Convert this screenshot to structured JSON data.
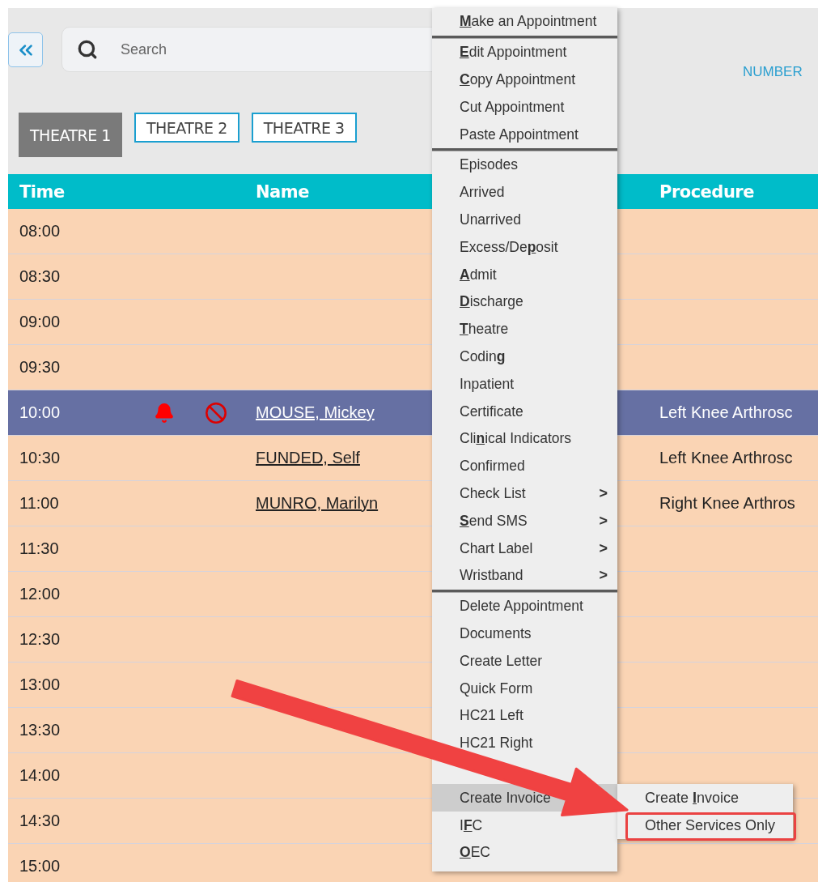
{
  "search": {
    "placeholder": "Search"
  },
  "header_link": "NUMBER",
  "theatre_tabs": [
    {
      "label": "THEATRE 1",
      "selected": true
    },
    {
      "label": "THEATRE 2",
      "selected": false
    },
    {
      "label": "THEATRE 3",
      "selected": false
    }
  ],
  "table": {
    "columns": [
      "Time",
      "Name",
      "Procedure"
    ],
    "rows": [
      {
        "time": "08:00",
        "selected": false,
        "alert": false,
        "blocked": false
      },
      {
        "time": "08:30",
        "selected": false,
        "alert": false,
        "blocked": false
      },
      {
        "time": "09:00",
        "selected": false,
        "alert": false,
        "blocked": false
      },
      {
        "time": "09:30",
        "selected": false,
        "alert": false,
        "blocked": false
      },
      {
        "time": "10:00",
        "name": "MOUSE, Mickey",
        "procedure": "Left Knee Arthrosc",
        "selected": true,
        "alert": true,
        "blocked": true
      },
      {
        "time": "10:30",
        "name": "FUNDED, Self",
        "procedure": "Left Knee Arthrosc",
        "selected": false,
        "alert": false,
        "blocked": false
      },
      {
        "time": "11:00",
        "name": "MUNRO, Marilyn",
        "procedure": "Right Knee Arthros",
        "selected": false,
        "alert": false,
        "blocked": false
      },
      {
        "time": "11:30",
        "selected": false,
        "alert": false,
        "blocked": false
      },
      {
        "time": "12:00",
        "selected": false,
        "alert": false,
        "blocked": false
      },
      {
        "time": "12:30",
        "selected": false,
        "alert": false,
        "blocked": false
      },
      {
        "time": "13:00",
        "selected": false,
        "alert": false,
        "blocked": false
      },
      {
        "time": "13:30",
        "selected": false,
        "alert": false,
        "blocked": false
      },
      {
        "time": "14:00",
        "selected": false,
        "alert": false,
        "blocked": false
      },
      {
        "time": "14:30",
        "selected": false,
        "alert": false,
        "blocked": false
      },
      {
        "time": "15:00",
        "selected": false,
        "alert": false,
        "blocked": false
      }
    ]
  },
  "context_menu": {
    "groups": [
      [
        {
          "key": "M",
          "after": "ake an Appointment",
          "highlighted": false
        }
      ],
      [
        {
          "key": "E",
          "after": "dit Appointment",
          "highlighted": false
        },
        {
          "key": "C",
          "after": "opy Appointment",
          "highlighted": false
        },
        {
          "before": "Cut Appointment",
          "highlighted": false
        },
        {
          "before": "Paste Appointment",
          "highlighted": false
        }
      ],
      [
        {
          "before": "Episodes",
          "highlighted": false
        },
        {
          "before": "Arrived",
          "highlighted": false
        },
        {
          "before": "Unarrived",
          "highlighted": false
        },
        {
          "before": "Excess/De",
          "key": "p",
          "after": "osit",
          "highlighted": false
        },
        {
          "key": "A",
          "after": "dmit",
          "highlighted": false
        },
        {
          "key": "D",
          "after": "ischarge",
          "highlighted": false
        },
        {
          "key": "T",
          "after": "heatre",
          "highlighted": false
        },
        {
          "before": "Codin",
          "key": "g",
          "highlighted": false
        },
        {
          "before": "Inpatient",
          "highlighted": false
        },
        {
          "before": "Certificate",
          "highlighted": false
        },
        {
          "before": "Cli",
          "key": "n",
          "after": "ical Indicators",
          "highlighted": false
        },
        {
          "before": "Confirmed",
          "highlighted": false
        },
        {
          "before": "Check List",
          "arrow": ">",
          "highlighted": false
        },
        {
          "key": "S",
          "after": "end SMS",
          "arrow": ">",
          "highlighted": false
        },
        {
          "before": "Chart Label",
          "arrow": ">",
          "highlighted": false
        },
        {
          "before": "Wristband",
          "arrow": ">",
          "highlighted": false
        }
      ],
      [
        {
          "before": "Delete Appointment",
          "highlighted": false
        },
        {
          "before": "Documents",
          "highlighted": false
        },
        {
          "before": "Create Letter",
          "highlighted": false
        },
        {
          "before": "Quick Form",
          "highlighted": false
        },
        {
          "before": "HC21 Left",
          "highlighted": false
        },
        {
          "before": "HC21 Right",
          "highlighted": false
        },
        {
          "highlighted": false
        },
        {
          "before": "Create Invoice",
          "highlighted": true,
          "children": [
            {
              "before": "Create ",
              "key": "I",
              "after": "nvoice",
              "callout": false
            },
            {
              "before": "Other Services Only",
              "callout": true
            }
          ]
        },
        {
          "before": "I",
          "key": "F",
          "after": "C",
          "highlighted": false
        },
        {
          "key": "O",
          "after": "EC",
          "highlighted": false
        }
      ]
    ]
  }
}
